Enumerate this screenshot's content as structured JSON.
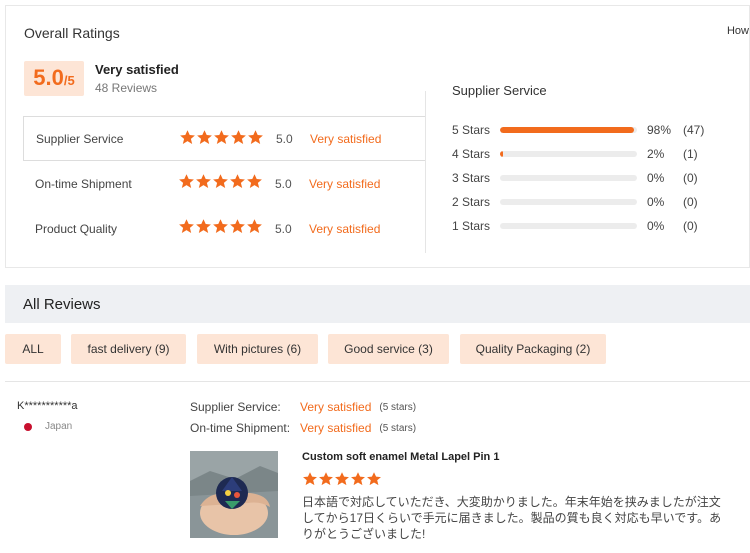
{
  "overall": {
    "title": "Overall Ratings",
    "how_link": "How",
    "score_main": "5.0",
    "score_suffix": "/5",
    "verdict": "Very satisfied",
    "reviews_count": "48 Reviews"
  },
  "categories": [
    {
      "name": "Supplier Service",
      "rating": 5.0,
      "score_text": "5.0",
      "verdict": "Very satisfied"
    },
    {
      "name": "On-time Shipment",
      "rating": 5.0,
      "score_text": "5.0",
      "verdict": "Very satisfied"
    },
    {
      "name": "Product Quality",
      "rating": 5.0,
      "score_text": "5.0",
      "verdict": "Very satisfied"
    }
  ],
  "distribution": {
    "title": "Supplier Service",
    "rows": [
      {
        "label": "5 Stars",
        "fraction": 0.98,
        "pct": "98%",
        "count": "(47)"
      },
      {
        "label": "4 Stars",
        "fraction": 0.02,
        "pct": "2%",
        "count": "(1)"
      },
      {
        "label": "3 Stars",
        "fraction": 0,
        "pct": "0%",
        "count": "(0)"
      },
      {
        "label": "2 Stars",
        "fraction": 0,
        "pct": "0%",
        "count": "(0)"
      },
      {
        "label": "1 Stars",
        "fraction": 0,
        "pct": "0%",
        "count": "(0)"
      }
    ]
  },
  "all_reviews": {
    "title": "All Reviews",
    "filters": [
      {
        "label": "ALL"
      },
      {
        "label": "fast delivery (9)"
      },
      {
        "label": "With pictures (6)"
      },
      {
        "label": "Good service (3)"
      },
      {
        "label": "Quality Packaging (2)"
      }
    ]
  },
  "review": {
    "reviewer": "K***********a",
    "country": "Japan",
    "meta": [
      {
        "label": "Supplier Service:",
        "value": "Very satisfied",
        "stars": "(5 stars)"
      },
      {
        "label": "On-time Shipment:",
        "value": "Very satisfied",
        "stars": "(5 stars)"
      }
    ],
    "product_title": "Custom soft enamel Metal Lapel Pin 1",
    "rating": 5,
    "text": "日本語で対応していただき、大変助かりました。年末年始を挟みましたが注文してから17日くらいで手元に届きました。製品の質も良く対応も早いです。ありがとうございました!"
  },
  "colors": {
    "accent": "#f26b1d",
    "chip_bg": "#fde5d6",
    "section_bg": "#eef0f3"
  }
}
